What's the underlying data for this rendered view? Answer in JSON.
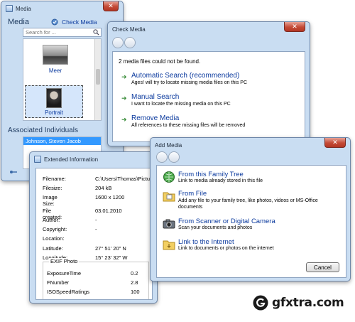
{
  "media": {
    "title": "Media",
    "header": "Media",
    "check_media": "Check Media",
    "search_placeholder": "Search for ...",
    "items": [
      {
        "label": "Meer"
      },
      {
        "label": "Portrait"
      }
    ],
    "associated_header": "Associated Individuals",
    "individuals": [
      "Johnson, Steven Jacob"
    ]
  },
  "check": {
    "title": "Check Media",
    "summary": "2 media files could not be found.",
    "options": [
      {
        "title": "Automatic Search (recommended)",
        "desc": "Ages! will try to locate missing media files on this PC"
      },
      {
        "title": "Manual Search",
        "desc": "I want to locate the missing media on this PC"
      },
      {
        "title": "Remove Media",
        "desc": "All references to these missing files will be removed"
      }
    ]
  },
  "extended": {
    "title": "Extended Information",
    "fields": [
      {
        "label": "Filename:",
        "value": "C:\\Users\\Thomas\\Pictur"
      },
      {
        "label": "Filesize:",
        "value": "204 kB"
      },
      {
        "label": "Image Size:",
        "value": "1600 x 1200"
      },
      {
        "label": "File created:",
        "value": "03.01.2010"
      },
      {
        "label": "Author:",
        "value": "-"
      },
      {
        "label": "Copyright:",
        "value": "-"
      },
      {
        "label": "Location:",
        "value": ""
      },
      {
        "label": "Latitude:",
        "value": "27° 51' 20\" N"
      },
      {
        "label": "Longitude:",
        "value": "15° 23' 32\" W"
      }
    ],
    "exif_title": "EXIF Photo",
    "exif": [
      {
        "label": "ExposureTime",
        "value": "0.2"
      },
      {
        "label": "FNumber",
        "value": "2.8"
      },
      {
        "label": "ISOSpeedRatings",
        "value": "100"
      }
    ]
  },
  "add": {
    "title": "Add Media",
    "options": [
      {
        "title": "From this Family Tree",
        "desc": "Link to media already stored in this file",
        "icon": "globe-icon"
      },
      {
        "title": "From File",
        "desc": "Add any file to your family tree, like photos, videos or MS-Office documents",
        "icon": "folder-icon"
      },
      {
        "title": "From Scanner or Digital Camera",
        "desc": "Scan your documents and photos",
        "icon": "camera-icon"
      },
      {
        "title": "Link to the Internet",
        "desc": "Link to documents or photos on the internet",
        "icon": "link-folder-icon"
      }
    ],
    "cancel": "Cancel"
  },
  "watermark": "gfxtra.com",
  "colors": {
    "link": "#0b3a9e",
    "accent": "#3a8d3a",
    "selection": "#3399ff"
  }
}
